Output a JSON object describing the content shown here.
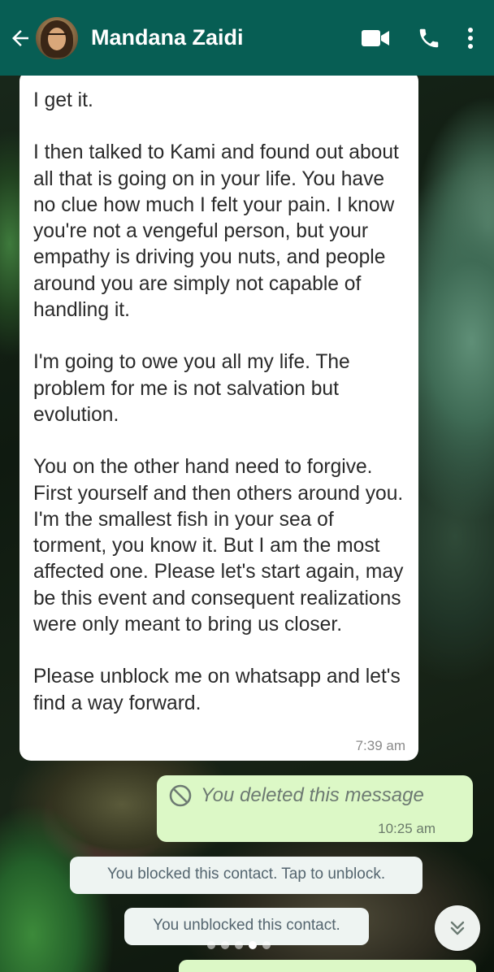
{
  "header": {
    "contact_name": "Mandana Zaidi",
    "back_icon": "arrow-left-icon",
    "video_icon": "video-call-icon",
    "call_icon": "phone-icon",
    "menu_icon": "more-vert-icon",
    "background_color": "#075e54"
  },
  "messages": {
    "incoming": {
      "paragraphs": [
        "I get it.",
        "I then talked to Kami and found out about all that is going on in your life. You have no clue how much I felt your pain. I know you're not a vengeful person, but your empathy is driving you nuts, and people around you are simply not capable of handling it.",
        "I'm going to owe you all my life. The problem for me is not salvation but evolution.",
        "You on the other hand need to forgive.  First yourself and then others around you. I'm the smallest fish in your sea of torment, you know it. But I am the most affected one. Please let's start again, may be this event and consequent realizations were only meant to bring us closer.",
        "Please unblock me on whatsapp and let's find a way forward."
      ],
      "time": "7:39 am"
    },
    "outgoing_deleted": {
      "text": "You deleted this message",
      "time": "10:25 am",
      "icon": "blocked-circle-icon",
      "bubble_color": "#dcf8c6"
    }
  },
  "system_notices": {
    "blocked": "You blocked this contact. Tap to unblock.",
    "unblocked": "You unblocked this contact."
  },
  "scroll_button": {
    "icon": "double-chevron-down-icon"
  },
  "page_indicator": {
    "count": 5,
    "active_index": 3
  }
}
